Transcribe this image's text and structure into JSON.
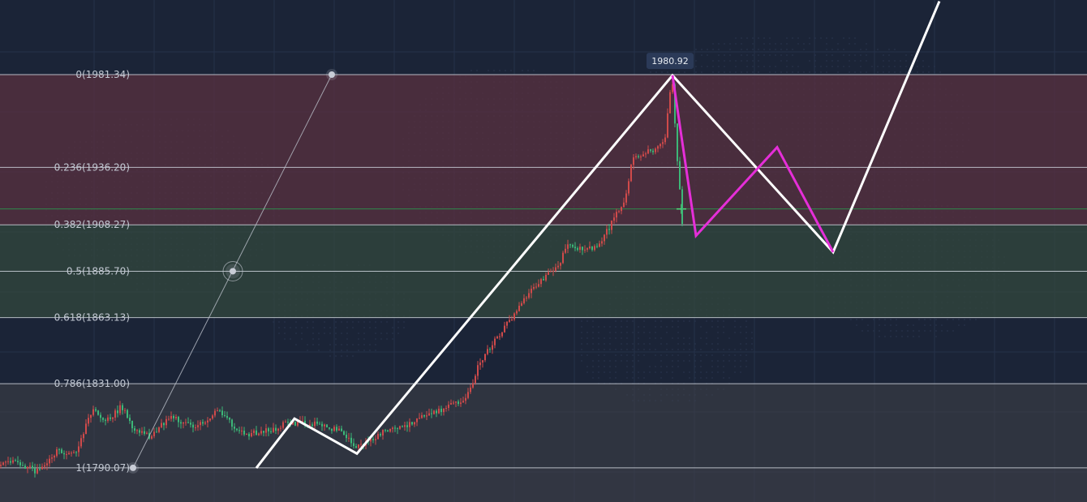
{
  "colors": {
    "background": "#1b2437",
    "grid": "#26324a",
    "fib_line": "#cfd4dc",
    "zone_red": "#5a3040",
    "zone_green": "#33473d",
    "zone_gray": "#3f4148",
    "candle_up": "#d04a4a",
    "candle_down": "#3cb878",
    "wave_white": "#ffffff",
    "wave_magenta": "#e52ed8",
    "crosshair": "#2e8b4d",
    "handle": "#c8ccd6"
  },
  "fib_levels": [
    {
      "ratio": 0,
      "price": 1981.34,
      "label": "0(1981.34)"
    },
    {
      "ratio": 0.236,
      "price": 1936.2,
      "label": "0.236(1936.20)"
    },
    {
      "ratio": 0.382,
      "price": 1908.27,
      "label": "0.382(1908.27)"
    },
    {
      "ratio": 0.5,
      "price": 1885.7,
      "label": "0.5(1885.70)"
    },
    {
      "ratio": 0.618,
      "price": 1863.13,
      "label": "0.618(1863.13)"
    },
    {
      "ratio": 0.786,
      "price": 1831.0,
      "label": "0.786(1831.00)"
    },
    {
      "ratio": 1,
      "price": 1790.07,
      "label": "1(1790.07)"
    }
  ],
  "price_tag": {
    "label": "1980.92",
    "price": 1980.92
  },
  "chart_data": {
    "type": "line",
    "title": "",
    "xlabel": "",
    "ylabel": "",
    "ylim": [
      1752,
      1997
    ],
    "grid": true,
    "legend": "none",
    "fibonacci": {
      "from_price": 1790.07,
      "to_price": 1981.34
    },
    "price_path": [
      [
        0,
        1791
      ],
      [
        20,
        1793
      ],
      [
        45,
        1788
      ],
      [
        58,
        1792
      ],
      [
        70,
        1798
      ],
      [
        95,
        1797
      ],
      [
        105,
        1810
      ],
      [
        115,
        1818
      ],
      [
        130,
        1812
      ],
      [
        150,
        1820
      ],
      [
        165,
        1808
      ],
      [
        185,
        1805
      ],
      [
        210,
        1815
      ],
      [
        240,
        1810
      ],
      [
        270,
        1818
      ],
      [
        300,
        1806
      ],
      [
        330,
        1808
      ],
      [
        355,
        1812
      ],
      [
        380,
        1812
      ],
      [
        420,
        1808
      ],
      [
        440,
        1800
      ],
      [
        470,
        1807
      ],
      [
        500,
        1811
      ],
      [
        525,
        1815
      ],
      [
        550,
        1819
      ],
      [
        575,
        1824
      ],
      [
        590,
        1840
      ],
      [
        610,
        1852
      ],
      [
        625,
        1860
      ],
      [
        650,
        1874
      ],
      [
        670,
        1882
      ],
      [
        690,
        1890
      ],
      [
        700,
        1900
      ],
      [
        720,
        1895
      ],
      [
        740,
        1899
      ],
      [
        755,
        1910
      ],
      [
        770,
        1920
      ],
      [
        780,
        1940
      ],
      [
        795,
        1943
      ],
      [
        810,
        1945
      ],
      [
        820,
        1950
      ],
      [
        828,
        1981
      ],
      [
        835,
        1940
      ],
      [
        842,
        1905
      ]
    ],
    "series": [
      {
        "points": [
          [
            316,
            1790
          ],
          [
            363,
            1814
          ],
          [
            440,
            1797
          ],
          [
            829,
            1981
          ],
          [
            1027,
            1895
          ],
          [
            1158,
            2017
          ]
        ]
      },
      {
        "points": [
          [
            829,
            1981
          ],
          [
            858,
            1903
          ],
          [
            958,
            1946
          ],
          [
            1027,
            1895
          ]
        ]
      }
    ],
    "fib_handles": [
      [
        164,
        1790.07
      ],
      [
        287,
        1885.7
      ],
      [
        409,
        1981.34
      ]
    ],
    "crosshair_price": 1916
  }
}
